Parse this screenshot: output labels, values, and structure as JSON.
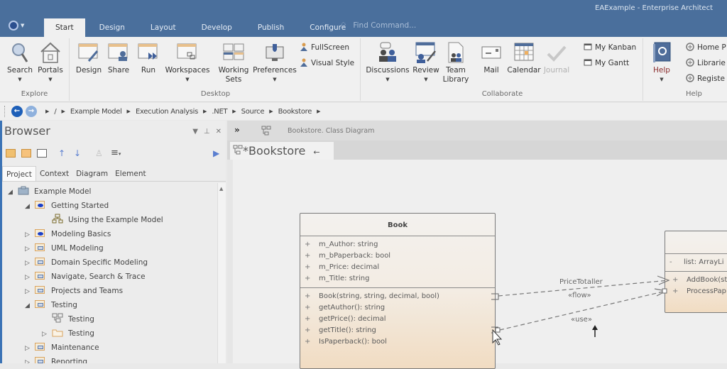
{
  "window": {
    "title": "EAExample - Enterprise Architect"
  },
  "ribbon_tabs": [
    "Start",
    "Design",
    "Layout",
    "Develop",
    "Publish",
    "Configure"
  ],
  "active_tab": "Start",
  "find_command": {
    "placeholder": "Find Command..."
  },
  "ribbon": {
    "explore": {
      "label": "Explore",
      "search": "Search",
      "portals": "Portals"
    },
    "desktop": {
      "label": "Desktop",
      "design": "Design",
      "share": "Share",
      "run": "Run",
      "workspaces": "Workspaces",
      "working_sets_1": "Working",
      "working_sets_2": "Sets",
      "preferences": "Preferences",
      "fullscreen": "FullScreen",
      "visual_style": "Visual Style"
    },
    "collaborate": {
      "label": "Collaborate",
      "discussions": "Discussions",
      "review": "Review",
      "team_library_1": "Team",
      "team_library_2": "Library",
      "mail": "Mail",
      "calendar": "Calendar",
      "journal": "Journal",
      "my_kanban": "My Kanban",
      "my_gantt": "My Gantt"
    },
    "help": {
      "label": "Help",
      "help": "Help",
      "home_page": "Home P",
      "libraries": "Librarie",
      "register": "Registe"
    }
  },
  "breadcrumb": {
    "root": "/",
    "items": [
      "Example Model",
      "Execution Analysis",
      ".NET",
      "Source",
      "Bookstore"
    ]
  },
  "browser": {
    "title": "Browser",
    "tabs": [
      "Project",
      "Context",
      "Diagram",
      "Element"
    ],
    "active_tab": "Project",
    "tree": [
      {
        "label": "Example Model",
        "level": 0,
        "state": "expanded",
        "icon": "model-root-icon"
      },
      {
        "label": "Getting Started",
        "level": 1,
        "state": "expanded",
        "icon": "package-blue-icon"
      },
      {
        "label": "Using the Example Model",
        "level": 2,
        "state": "leaf",
        "icon": "hierarchy-diagram-icon"
      },
      {
        "label": "Modeling Basics",
        "level": 1,
        "state": "collapsed",
        "icon": "package-blue-icon"
      },
      {
        "label": "UML Modeling",
        "level": 1,
        "state": "collapsed",
        "icon": "package-icon"
      },
      {
        "label": "Domain Specific Modeling",
        "level": 1,
        "state": "collapsed",
        "icon": "package-icon"
      },
      {
        "label": "Navigate, Search & Trace",
        "level": 1,
        "state": "collapsed",
        "icon": "package-icon"
      },
      {
        "label": "Projects and Teams",
        "level": 1,
        "state": "collapsed",
        "icon": "package-icon"
      },
      {
        "label": "Testing",
        "level": 1,
        "state": "expanded",
        "icon": "package-icon"
      },
      {
        "label": "Testing",
        "level": 2,
        "state": "leaf",
        "icon": "class-diagram-icon"
      },
      {
        "label": "Testing",
        "level": 2,
        "state": "collapsed",
        "icon": "folder-icon"
      },
      {
        "label": "Maintenance",
        "level": 1,
        "state": "collapsed",
        "icon": "package-icon"
      },
      {
        "label": "Reporting",
        "level": 1,
        "state": "collapsed",
        "icon": "package-icon"
      }
    ]
  },
  "diagram": {
    "header_path": "Bookstore.  Class Diagram",
    "tab_title": "*Bookstore",
    "classes": [
      {
        "name": "Book",
        "attributes": [
          {
            "vis": "+",
            "text": "m_Author: string"
          },
          {
            "vis": "+",
            "text": "m_bPaperback: bool"
          },
          {
            "vis": "+",
            "text": "m_Price: decimal"
          },
          {
            "vis": "+",
            "text": "m_Title: string"
          }
        ],
        "operations": [
          {
            "vis": "+",
            "text": "Book(string, string, decimal, bool)"
          },
          {
            "vis": "+",
            "text": "getAuthor(): string"
          },
          {
            "vis": "+",
            "text": "getPrice(): decimal"
          },
          {
            "vis": "+",
            "text": "getTitle(): string"
          },
          {
            "vis": "+",
            "text": "IsPaperback(): bool"
          }
        ]
      },
      {
        "name": "",
        "attributes": [
          {
            "vis": "-",
            "text": "list: ArrayLi"
          }
        ],
        "operations": [
          {
            "vis": "+",
            "text": "AddBook(st"
          },
          {
            "vis": "+",
            "text": "ProcessPap"
          }
        ]
      }
    ],
    "connectors": [
      {
        "label": "PriceTotaller",
        "stereotype": "«flow»"
      },
      {
        "label": "",
        "stereotype": "«use»"
      }
    ]
  }
}
